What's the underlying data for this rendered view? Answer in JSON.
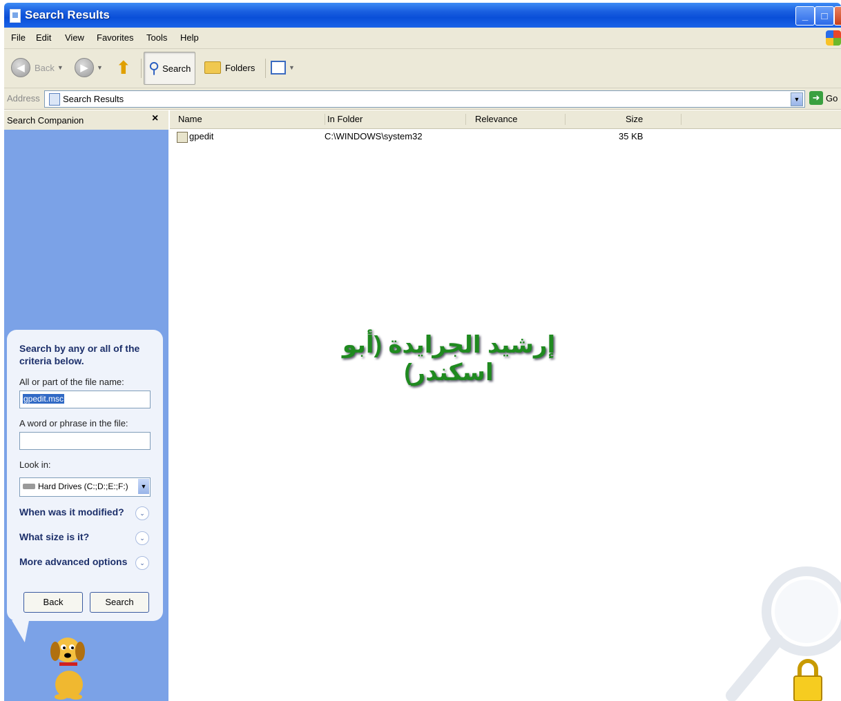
{
  "window": {
    "title": "Search Results"
  },
  "menu": [
    "File",
    "Edit",
    "View",
    "Favorites",
    "Tools",
    "Help"
  ],
  "toolbar": {
    "back": "Back",
    "search": "Search",
    "folders": "Folders"
  },
  "address": {
    "label": "Address",
    "value": "Search Results",
    "go": "Go"
  },
  "side": {
    "header": "Search Companion",
    "title": "Search by any or all of the criteria below.",
    "name_label": "All or part of the file name:",
    "name_value": "gpedit.msc",
    "phrase_label": "A word or phrase in the file:",
    "phrase_value": "",
    "lookin_label": "Look in:",
    "lookin_value": "Hard Drives (C:;D:;E:;F:)",
    "modified": "When was it modified?",
    "size": "What size is it?",
    "advanced": "More advanced options",
    "back_button": "Back",
    "search_button": "Search"
  },
  "columns": [
    "Name",
    "In Folder",
    "Relevance",
    "Size"
  ],
  "results": [
    {
      "name": "gpedit",
      "folder": "C:\\WINDOWS\\system32",
      "relevance": "",
      "size": "35 KB"
    }
  ],
  "watermark": "إرشيد الجرايدة (أبو اسكندر)"
}
